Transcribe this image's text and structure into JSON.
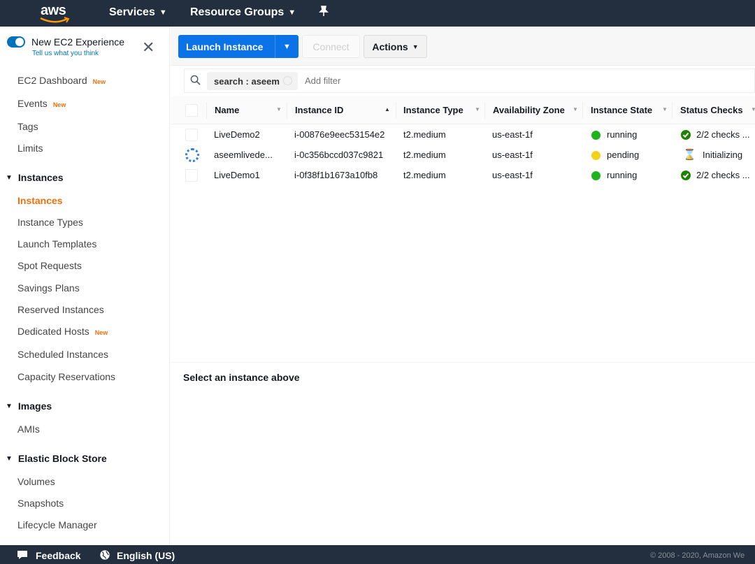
{
  "topnav": {
    "logo": "aws",
    "services": "Services",
    "resource_groups": "Resource Groups"
  },
  "sidebar": {
    "experience_title": "New EC2 Experience",
    "experience_link": "Tell us what you think",
    "links_top": [
      {
        "label": "EC2 Dashboard",
        "badge": "New"
      },
      {
        "label": "Events",
        "badge": "New"
      },
      {
        "label": "Tags",
        "badge": ""
      },
      {
        "label": "Limits",
        "badge": ""
      }
    ],
    "sections": {
      "instances": "Instances",
      "images": "Images",
      "ebs": "Elastic Block Store"
    },
    "instances_items": [
      {
        "label": "Instances",
        "badge": ""
      },
      {
        "label": "Instance Types",
        "badge": ""
      },
      {
        "label": "Launch Templates",
        "badge": ""
      },
      {
        "label": "Spot Requests",
        "badge": ""
      },
      {
        "label": "Savings Plans",
        "badge": ""
      },
      {
        "label": "Reserved Instances",
        "badge": ""
      },
      {
        "label": "Dedicated Hosts",
        "badge": "New"
      },
      {
        "label": "Scheduled Instances",
        "badge": ""
      },
      {
        "label": "Capacity Reservations",
        "badge": ""
      }
    ],
    "images_items": [
      {
        "label": "AMIs"
      }
    ],
    "ebs_items": [
      {
        "label": "Volumes"
      },
      {
        "label": "Snapshots"
      },
      {
        "label": "Lifecycle Manager"
      }
    ]
  },
  "toolbar": {
    "launch_label": "Launch Instance",
    "connect_label": "Connect",
    "actions_label": "Actions"
  },
  "filter": {
    "chip": "search : aseem",
    "placeholder": "Add filter"
  },
  "table": {
    "headers": [
      "Name",
      "Instance ID",
      "Instance Type",
      "Availability Zone",
      "Instance State",
      "Status Checks"
    ],
    "rows": [
      {
        "name": "LiveDemo2",
        "id": "i-00876e9eec53154e2",
        "type": "t2.medium",
        "az": "us-east-1f",
        "state": "running",
        "state_color": "#1db31d",
        "status": "2/2 checks ...",
        "status_icon": "check-icon"
      },
      {
        "name": "aseemlivede...",
        "id": "i-0c356bccd037c9821",
        "type": "t2.medium",
        "az": "us-east-1f",
        "state": "pending",
        "state_color": "#f2d21a",
        "status": "Initializing",
        "status_icon": "hourglass-icon"
      },
      {
        "name": "LiveDemo1",
        "id": "i-0f38f1b1673a10fb8",
        "type": "t2.medium",
        "az": "us-east-1f",
        "state": "running",
        "state_color": "#1db31d",
        "status": "2/2 checks ...",
        "status_icon": "check-icon"
      }
    ]
  },
  "detail": {
    "message": "Select an instance above"
  },
  "footer": {
    "feedback": "Feedback",
    "language": "English (US)",
    "copyright": "© 2008 - 2020, Amazon We"
  },
  "colors": {
    "nav_bg": "#232f3e",
    "primary": "#0b72e7",
    "accent_orange": "#ec7211"
  }
}
